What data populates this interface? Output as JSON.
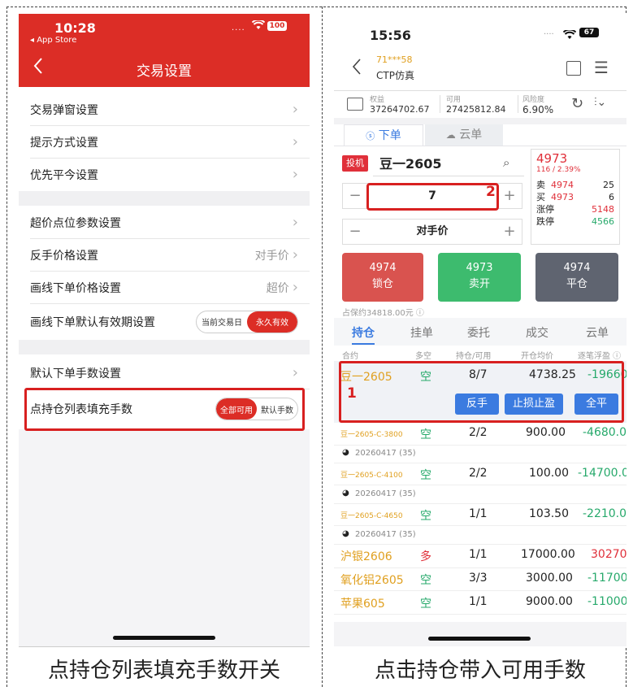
{
  "left": {
    "status_time": "10:28",
    "status_back": "◂ App Store",
    "battery": "100",
    "nav_title": "交易设置",
    "group1": [
      "交易弹窗设置",
      "提示方式设置",
      "优先平今设置"
    ],
    "group2": [
      {
        "label": "超价点位参数设置",
        "value": ""
      },
      {
        "label": "反手价格设置",
        "value": "对手价"
      },
      {
        "label": "画线下单价格设置",
        "value": "超价"
      },
      {
        "label": "画线下单默认有效期设置",
        "toggle": [
          "当前交易日",
          "永久有效"
        ]
      }
    ],
    "group3": [
      {
        "label": "默认下单手数设置"
      },
      {
        "label": "点持仓列表填充手数",
        "toggle": [
          "全部可用",
          "默认手数"
        ]
      }
    ],
    "caption": "点持仓列表填充手数开关"
  },
  "right": {
    "status_time": "15:56",
    "battery": "67",
    "account_id": "71***58",
    "account_name": "CTP仿真",
    "stats": [
      {
        "label": "权益",
        "value": "37264702.67"
      },
      {
        "label": "可用",
        "value": "27425812.84"
      },
      {
        "label": "风险度",
        "value": "6.90%"
      }
    ],
    "tabs": [
      "下单",
      "云单"
    ],
    "order_type": "投机",
    "contract": "豆一2605",
    "quantity": "7",
    "price_mode": "对手价",
    "quote": {
      "last": "4973",
      "change": "116 / 2.39%",
      "sell_label": "卖",
      "sell_price": "4974",
      "sell_qty": "25",
      "buy_label": "买",
      "buy_price": "4973",
      "buy_qty": "6",
      "up_label": "涨停",
      "up_price": "5148",
      "down_label": "跌停",
      "down_price": "4566"
    },
    "buttons": [
      {
        "price": "4974",
        "label": "锁仓",
        "color": "#d9534f"
      },
      {
        "price": "4973",
        "label": "卖开",
        "color": "#3dbb6e"
      },
      {
        "price": "4974",
        "label": "平仓",
        "color": "#5f6470"
      }
    ],
    "margin_text": "占保约34818.00元 ⓘ",
    "list_tabs": [
      "持仓",
      "挂单",
      "委托",
      "成交",
      "云单"
    ],
    "columns": [
      "合约",
      "多空",
      "持仓/可用",
      "开仓均价",
      "逐笔浮盈 ⓘ"
    ],
    "selected_row": {
      "contract": "豆一2605",
      "side": "空",
      "qty": "8/7",
      "price": "4738.25",
      "pnl": "-19660"
    },
    "row_actions": [
      "反手",
      "止损止盈",
      "全平"
    ],
    "rows": [
      {
        "contract": "豆一2605-C-3800",
        "side": "空",
        "qty": "2/2",
        "price": "900.00",
        "pnl": "-4680.0",
        "expiry": "20260417 (35)",
        "small": true
      },
      {
        "contract": "豆一2605-C-4100",
        "side": "空",
        "qty": "2/2",
        "price": "100.00",
        "pnl": "-14700.0",
        "expiry": "20260417 (35)",
        "small": true
      },
      {
        "contract": "豆一2605-C-4650",
        "side": "空",
        "qty": "1/1",
        "price": "103.50",
        "pnl": "-2210.0",
        "expiry": "20260417 (35)",
        "small": true
      },
      {
        "contract": "沪银2606",
        "side": "多",
        "qty": "1/1",
        "price": "17000.00",
        "pnl": "30270",
        "small": false
      },
      {
        "contract": "氧化铝2605",
        "side": "空",
        "qty": "3/3",
        "price": "3000.00",
        "pnl": "-11700",
        "small": false
      },
      {
        "contract": "苹果605",
        "side": "空",
        "qty": "1/1",
        "price": "9000.00",
        "pnl": "-11000",
        "small": false
      }
    ],
    "caption": "点击持仓带入可用手数"
  },
  "annotations": [
    "1",
    "2"
  ]
}
